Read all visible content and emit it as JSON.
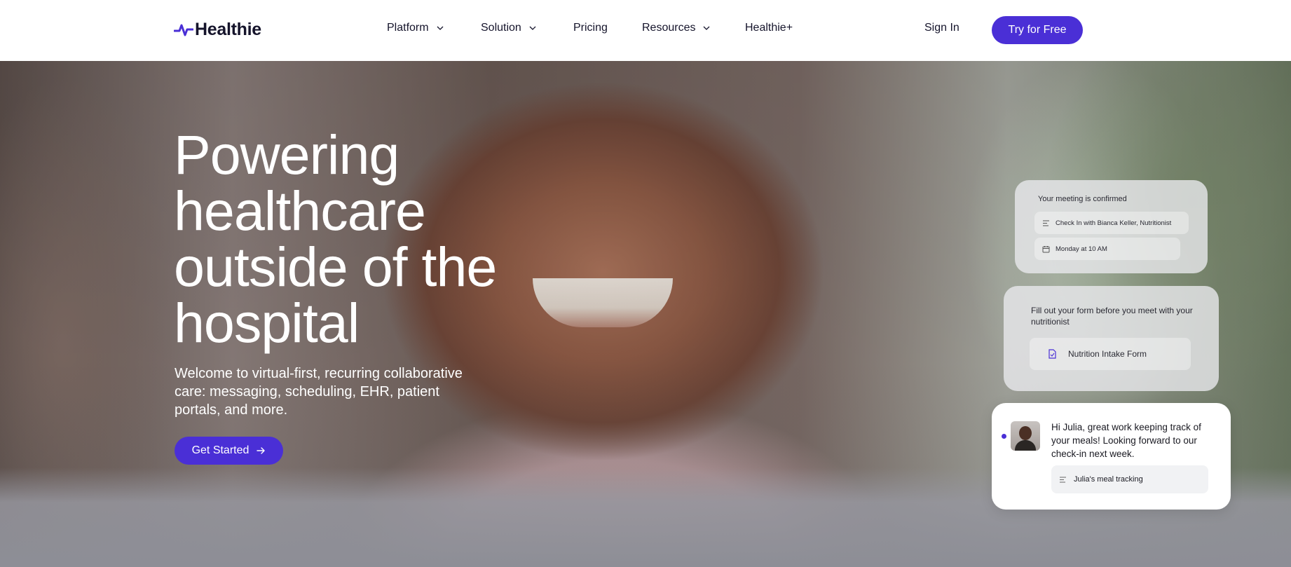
{
  "brand": {
    "name": "Healthie",
    "accent": "#4a2fd6",
    "logo_icon": "pulse-logo-icon"
  },
  "nav": {
    "items": [
      {
        "label": "Platform",
        "has_dropdown": true
      },
      {
        "label": "Solution",
        "has_dropdown": true
      },
      {
        "label": "Pricing",
        "has_dropdown": false
      },
      {
        "label": "Resources",
        "has_dropdown": true
      },
      {
        "label": "Healthie+",
        "has_dropdown": false
      }
    ],
    "sign_in": "Sign In",
    "try_free": "Try for Free"
  },
  "hero": {
    "title": "Powering healthcare outside of the hospital",
    "subtitle": "Welcome to virtual-first, recurring collaborative care: messaging, scheduling, EHR, patient portals, and more.",
    "cta": "Get Started"
  },
  "cards": {
    "meeting": {
      "title": "Your meeting is confirmed",
      "detail": "Check In with Bianca Keller, Nutritionist",
      "time": "Monday at 10 AM"
    },
    "form": {
      "title": "Fill out your form before you meet with your nutritionist",
      "form_name": "Nutrition Intake Form"
    },
    "message": {
      "text": "Hi Julia, great work keeping track of your meals! Looking forward to our check-in next week.",
      "attachment": "Julia's meal tracking"
    }
  }
}
